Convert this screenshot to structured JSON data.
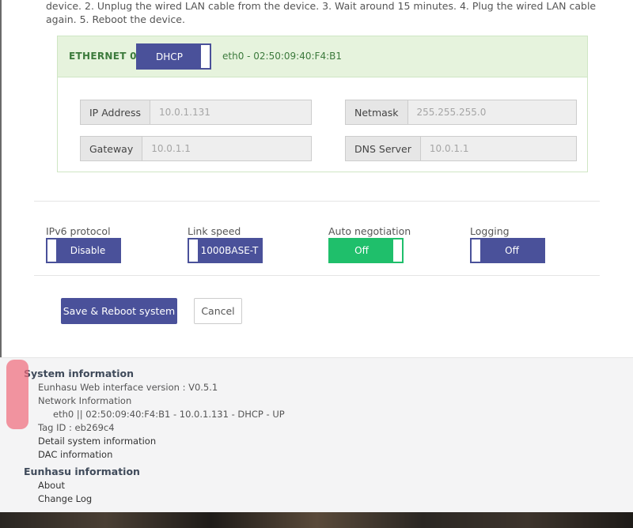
{
  "instructions": {
    "text": "device. 2. Unplug the wired LAN cable from the device. 3. Wait around 15 minutes. 4. Plug the wired LAN cable again. 5. Reboot the device."
  },
  "ethernet": {
    "title": "ETHERNET 0",
    "mode": "DHCP",
    "mac_info": "eth0  -  02:50:09:40:F4:B1",
    "ip_label": "IP Address",
    "ip_value": "10.0.1.131",
    "netmask_label": "Netmask",
    "netmask_value": "255.255.255.0",
    "gateway_label": "Gateway",
    "gateway_value": "10.0.1.1",
    "dns_label": "DNS Server",
    "dns_value": "10.0.1.1"
  },
  "options": {
    "ipv6_label": "IPv6 protocol",
    "ipv6_value": "Disable",
    "link_speed_label": "Link speed",
    "link_speed_value": "1000BASE-T",
    "auto_neg_label": "Auto negotiation",
    "auto_neg_value": "Off",
    "logging_label": "Logging",
    "logging_value": "Off"
  },
  "actions": {
    "save_label": "Save & Reboot system",
    "cancel_label": "Cancel"
  },
  "system_info": {
    "title": "System information",
    "version": "Eunhasu Web interface version : V0.5.1",
    "network_info_label": "Network Information",
    "network_detail": "eth0 || 02:50:09:40:F4:B1 - 10.0.1.131 - DHCP - UP",
    "tag_id": "Tag ID : eb269c4",
    "detail_link": "Detail system information",
    "dac_link": "DAC information"
  },
  "eunhasu_info": {
    "title": "Eunhasu information",
    "about_link": "About",
    "changelog_link": "Change Log"
  },
  "colors": {
    "primary": "#4a519a",
    "success": "#1fbf6b",
    "eth_header_bg": "#e6f3dd",
    "eth_title": "#3c7a3c"
  }
}
